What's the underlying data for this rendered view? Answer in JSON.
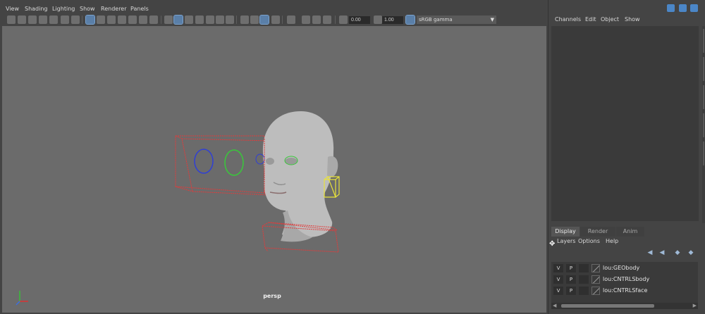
{
  "viewport_menu": [
    "View",
    "Shading",
    "Lighting",
    "Show",
    "Renderer",
    "Panels"
  ],
  "toolbar": {
    "exposure_value": "0.00",
    "gamma_value": "1.00",
    "color_space": "sRGB gamma"
  },
  "viewport": {
    "camera_label": "persp",
    "background_color": "#6b6b6b"
  },
  "channel_menu": [
    "Channels",
    "Edit",
    "Object",
    "Show"
  ],
  "layer_tabs": [
    "Display",
    "Render",
    "Anim"
  ],
  "layer_menu": [
    "Layers",
    "Options",
    "Help"
  ],
  "layers": [
    {
      "visible": "V",
      "playback": "P",
      "name": "lou:GEObody"
    },
    {
      "visible": "V",
      "playback": "P",
      "name": "lou:CNTRLSbody"
    },
    {
      "visible": "V",
      "playback": "P",
      "name": "lou:CNTRLSface"
    }
  ],
  "colors": {
    "accent": "#5a7fa8",
    "control_red": "#e23b3b",
    "control_green": "#39c93a",
    "control_blue": "#2f3fd6",
    "control_yellow": "#e8e23a"
  },
  "icons": [
    "camera-icon",
    "grid-icon",
    "wireframe-icon",
    "lights-icon",
    "isolate-icon",
    "xray-icon",
    "exposure-icon",
    "gamma-icon",
    "color-management-icon"
  ]
}
